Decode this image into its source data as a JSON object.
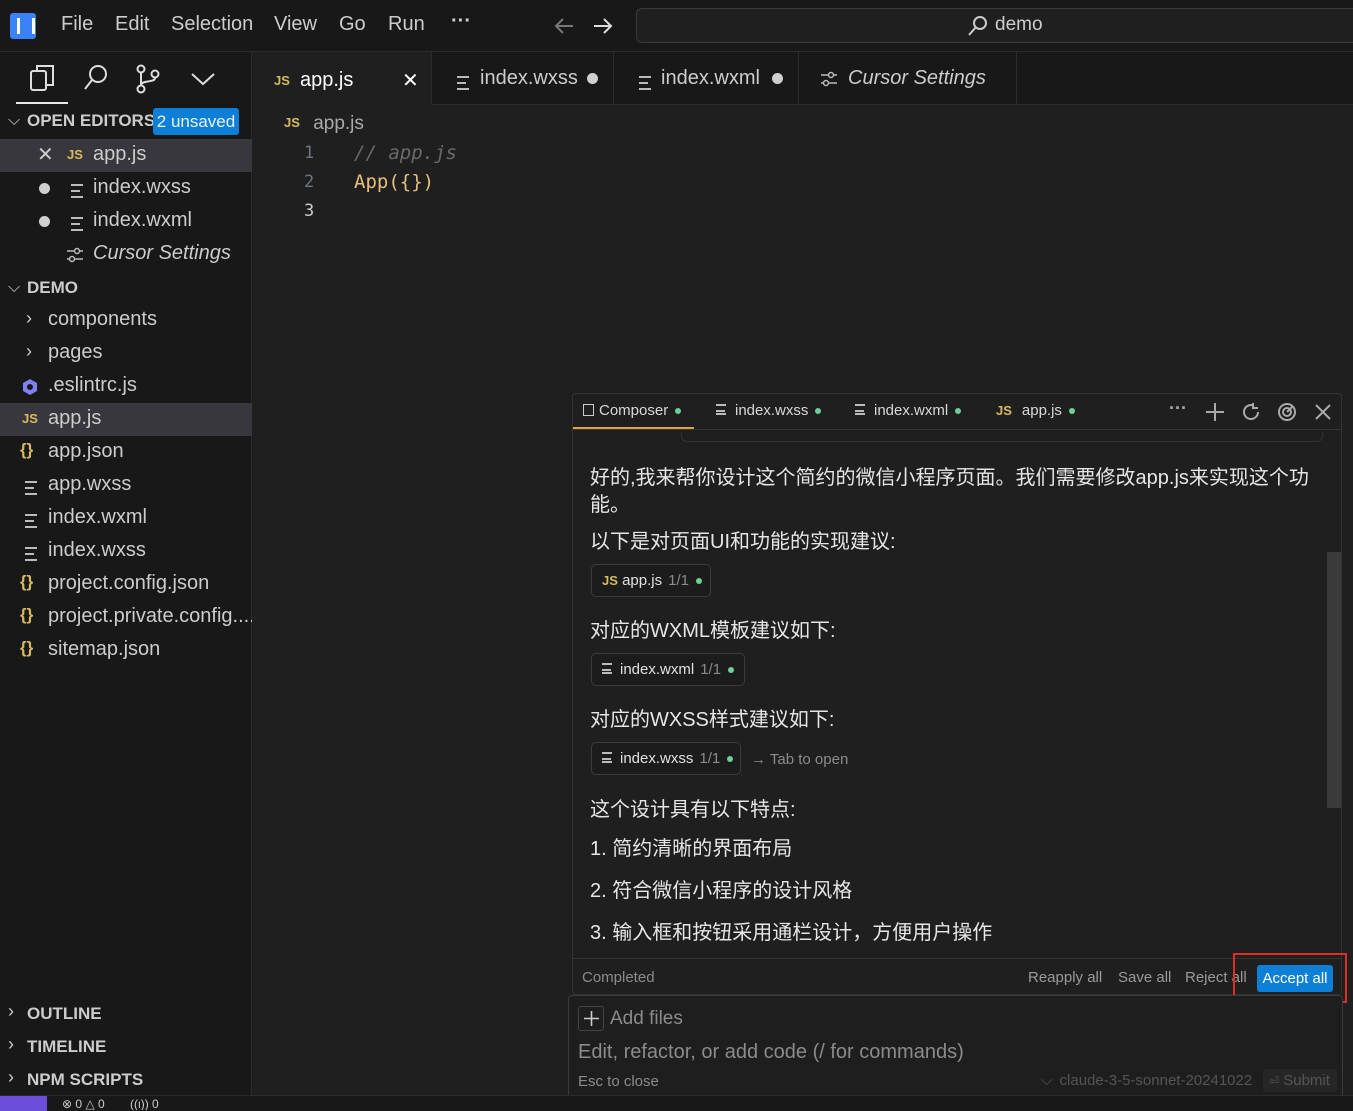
{
  "titlebar": {
    "menus": [
      "File",
      "Edit",
      "Selection",
      "View",
      "Go",
      "Run"
    ],
    "more": "···",
    "search": "demo"
  },
  "sidebar": {
    "open_editors_title": "OPEN EDITORS",
    "unsaved_badge": "2 unsaved",
    "open_editors": [
      {
        "label": "app.js",
        "icon": "JS",
        "state": "close"
      },
      {
        "label": "index.wxss",
        "icon": "≡",
        "state": "dirty"
      },
      {
        "label": "index.wxml",
        "icon": "≡",
        "state": "dirty"
      },
      {
        "label": "Cursor Settings",
        "icon": "settings",
        "state": "none"
      }
    ],
    "folder_title": "DEMO",
    "tree": [
      {
        "label": "components",
        "type": "folder"
      },
      {
        "label": "pages",
        "type": "folder"
      },
      {
        "label": ".eslintrc.js",
        "type": "eslint"
      },
      {
        "label": "app.js",
        "type": "js"
      },
      {
        "label": "app.json",
        "type": "json"
      },
      {
        "label": "app.wxss",
        "type": "lines"
      },
      {
        "label": "index.wxml",
        "type": "lines"
      },
      {
        "label": "index.wxss",
        "type": "lines"
      },
      {
        "label": "project.config.json",
        "type": "json"
      },
      {
        "label": "project.private.config....",
        "type": "json"
      },
      {
        "label": "sitemap.json",
        "type": "json"
      }
    ],
    "bottom_sections": [
      "OUTLINE",
      "TIMELINE",
      "NPM SCRIPTS"
    ]
  },
  "tabs": [
    {
      "label": "app.js",
      "icon": "JS",
      "close": "✕"
    },
    {
      "label": "index.wxss",
      "icon": "≡"
    },
    {
      "label": "index.wxml",
      "icon": "≡"
    },
    {
      "label": "Cursor Settings",
      "icon": "settings"
    }
  ],
  "editor": {
    "breadcrumb_icon": "JS",
    "breadcrumb": "app.js",
    "lines": [
      {
        "num": "1",
        "code": "// app.js"
      },
      {
        "num": "2",
        "code": "App({})"
      },
      {
        "num": "3",
        "code": ""
      }
    ]
  },
  "composer": {
    "tabs": [
      {
        "label": "Composer"
      },
      {
        "label": "index.wxss"
      },
      {
        "label": "index.wxml"
      },
      {
        "label": "app.js"
      }
    ],
    "msg1a": "好的,我来帮你设计这个简约的微信小程序页面。我们需要修改app.js来实现这个功",
    "msg1b": "能。",
    "msg2": "以下是对页面UI和功能的实现建议:",
    "chip1": {
      "icon": "JS",
      "label": "app.js",
      "frac": "1/1"
    },
    "msg3": "对应的WXML模板建议如下:",
    "chip2": {
      "label": "index.wxml",
      "frac": "1/1"
    },
    "msg4": "对应的WXSS样式建议如下:",
    "chip3": {
      "label": "index.wxss",
      "frac": "1/1"
    },
    "tab_hint": "→ Tab to open",
    "msg5": "这个设计具有以下特点:",
    "points": [
      "1. 简约清晰的界面布局",
      "2. 符合微信小程序的设计风格",
      "3. 输入框和按钮采用通栏设计，方便用户操作"
    ],
    "status": "Completed",
    "reapply": "Reapply all",
    "save": "Save all",
    "reject": "Reject all",
    "accept": "Accept all"
  },
  "input": {
    "add_files": "Add files",
    "placeholder": "Edit, refactor, or add code (/ for commands)",
    "esc": "Esc to close",
    "model": "claude-3-5-sonnet-20241022",
    "submit": "Submit"
  },
  "statusbar": {
    "errors": "0",
    "warnings": "0",
    "ports": "0"
  },
  "colors": {
    "accent": "#0e7fd6",
    "js_icon": "#d7ba5c",
    "green_dot": "#6fcf97",
    "highlight_box": "#e02b2b"
  }
}
